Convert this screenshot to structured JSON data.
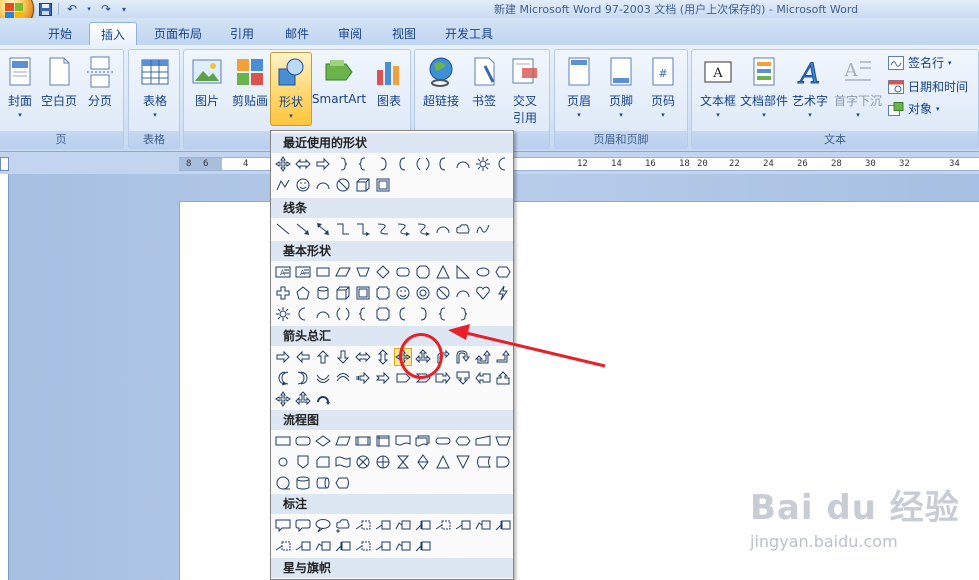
{
  "window": {
    "title": "新建 Microsoft Word 97-2003 文档 (用户上次保存的) - Microsoft Word"
  },
  "tabs": [
    {
      "label": "开始"
    },
    {
      "label": "插入"
    },
    {
      "label": "页面布局"
    },
    {
      "label": "引用"
    },
    {
      "label": "邮件"
    },
    {
      "label": "审阅"
    },
    {
      "label": "视图"
    },
    {
      "label": "开发工具"
    }
  ],
  "active_tab": "插入",
  "ribbon": {
    "groups": [
      {
        "label": "页"
      },
      {
        "label": "表格"
      },
      {
        "label": ""
      },
      {
        "label": ""
      },
      {
        "label": "页眉和页脚"
      },
      {
        "label": "文本"
      }
    ],
    "buttons": {
      "cover": "封面",
      "blank_page": "空白页",
      "page_break": "分页",
      "table": "表格",
      "picture": "图片",
      "clipart": "剪贴画",
      "shapes": "形状",
      "smartart": "SmartArt",
      "chart": "图表",
      "hyperlink": "超链接",
      "bookmark": "书签",
      "cross_ref_line1": "交叉",
      "cross_ref_line2": "引用",
      "header": "页眉",
      "footer": "页脚",
      "page_number": "页码",
      "textbox": "文本框",
      "quick_parts": "文档部件",
      "wordart": "艺术字",
      "drop_cap": "首字下沉",
      "signature_line": "签名行",
      "date_time": "日期和时间",
      "object": "对象"
    }
  },
  "ruler": {
    "left_labels": [
      "8",
      "6",
      "4"
    ],
    "right_labels": [
      "12",
      "14",
      "16",
      "18",
      "20",
      "22",
      "24",
      "26",
      "28",
      "30",
      "32",
      "34"
    ]
  },
  "shapes_menu": {
    "sections": [
      {
        "title": "最近使用的形状"
      },
      {
        "title": "线条"
      },
      {
        "title": "基本形状"
      },
      {
        "title": "箭头总汇"
      },
      {
        "title": "流程图"
      },
      {
        "title": "标注"
      },
      {
        "title": "星与旗帜"
      }
    ],
    "selected_shape": "u-turn-arrow"
  },
  "watermark": {
    "logo": "Bai du 经验",
    "url": "jingyan.baidu.com"
  },
  "colors": {
    "accent_red": "#e8202a",
    "selected_highlight": "#ffe699",
    "ribbon_text": "#15428b"
  }
}
